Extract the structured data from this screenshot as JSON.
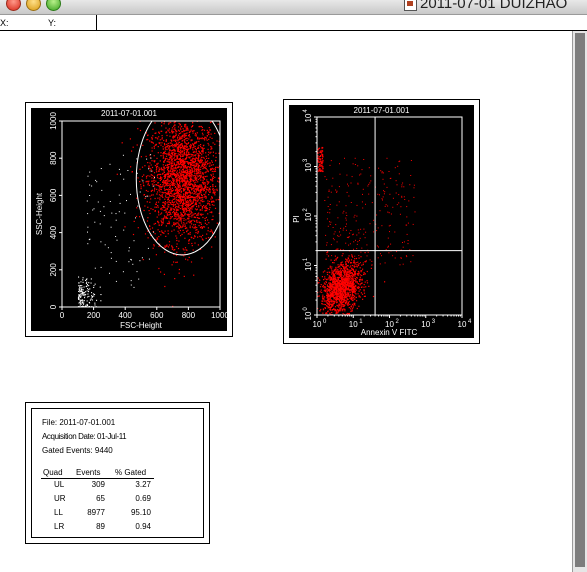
{
  "window": {
    "title": "2011-07-01 DUIZHAO"
  },
  "coord_bar": {
    "x_label": "X:",
    "y_label": "Y:"
  },
  "colors": {
    "plot_background": "#000000",
    "events": "#ff0000",
    "gate": "#ffffff",
    "axis": "#ffffff"
  },
  "scatter_plot": {
    "title": "2011-07-01.001",
    "x_label": "FSC-Height",
    "y_label": "SSC-Height",
    "x_ticks": [
      "0",
      "200",
      "400",
      "600",
      "800",
      "1000"
    ],
    "y_ticks": [
      "0",
      "200",
      "400",
      "600",
      "800",
      "1000"
    ]
  },
  "quadrant_plot": {
    "title": "2011-07-01.001",
    "x_label": "Annexin V FITC",
    "y_label": "PI",
    "x_ticks": [
      "10",
      "10",
      "10",
      "10",
      "10"
    ],
    "x_exps": [
      "0",
      "1",
      "2",
      "3",
      "4"
    ],
    "y_ticks": [
      "10",
      "10",
      "10",
      "10",
      "10"
    ],
    "y_exps": [
      "0",
      "1",
      "2",
      "3",
      "4"
    ]
  },
  "stats": {
    "file_line": "File: 2011-07-01.001",
    "acq_line": "Acquisition Date: 01-Jul-11",
    "gated_line": "Gated Events: 9440",
    "headers": [
      "Quad",
      "Events",
      "% Gated"
    ],
    "rows": [
      {
        "quad": "UL",
        "events": "309",
        "pct": "3.27"
      },
      {
        "quad": "UR",
        "events": "65",
        "pct": "0.69"
      },
      {
        "quad": "LL",
        "events": "8977",
        "pct": "95.10"
      },
      {
        "quad": "LR",
        "events": "89",
        "pct": "0.94"
      }
    ]
  },
  "chart_data": [
    {
      "type": "scatter",
      "title": "2011-07-01.001",
      "xlabel": "FSC-Height",
      "ylabel": "SSC-Height",
      "xlim": [
        0,
        1000
      ],
      "ylim": [
        0,
        1000
      ],
      "gate": {
        "shape": "ellipse",
        "center": [
          760,
          690
        ],
        "radius": [
          290,
          410
        ]
      },
      "clusters": [
        {
          "name": "main population",
          "center": [
            760,
            690
          ],
          "spread": [
            110,
            170
          ],
          "color": "#ff0000"
        },
        {
          "name": "debris",
          "center": [
            100,
            70
          ],
          "spread": [
            60,
            45
          ],
          "color": "#ffffff"
        }
      ],
      "grid": false
    },
    {
      "type": "scatter",
      "title": "2011-07-01.001",
      "xlabel": "Annexin V FITC",
      "ylabel": "PI",
      "xlim": [
        1,
        10000
      ],
      "ylim": [
        1,
        10000
      ],
      "scale": "log",
      "quadrant_lines": {
        "x": 40,
        "y": 20
      },
      "quadrants": [
        {
          "quad": "UL",
          "events": 309,
          "pct_gated": 3.27
        },
        {
          "quad": "UR",
          "events": 65,
          "pct_gated": 0.69
        },
        {
          "quad": "LL",
          "events": 8977,
          "pct_gated": 95.1
        },
        {
          "quad": "LR",
          "events": 89,
          "pct_gated": 0.94
        }
      ],
      "grid": false
    }
  ]
}
